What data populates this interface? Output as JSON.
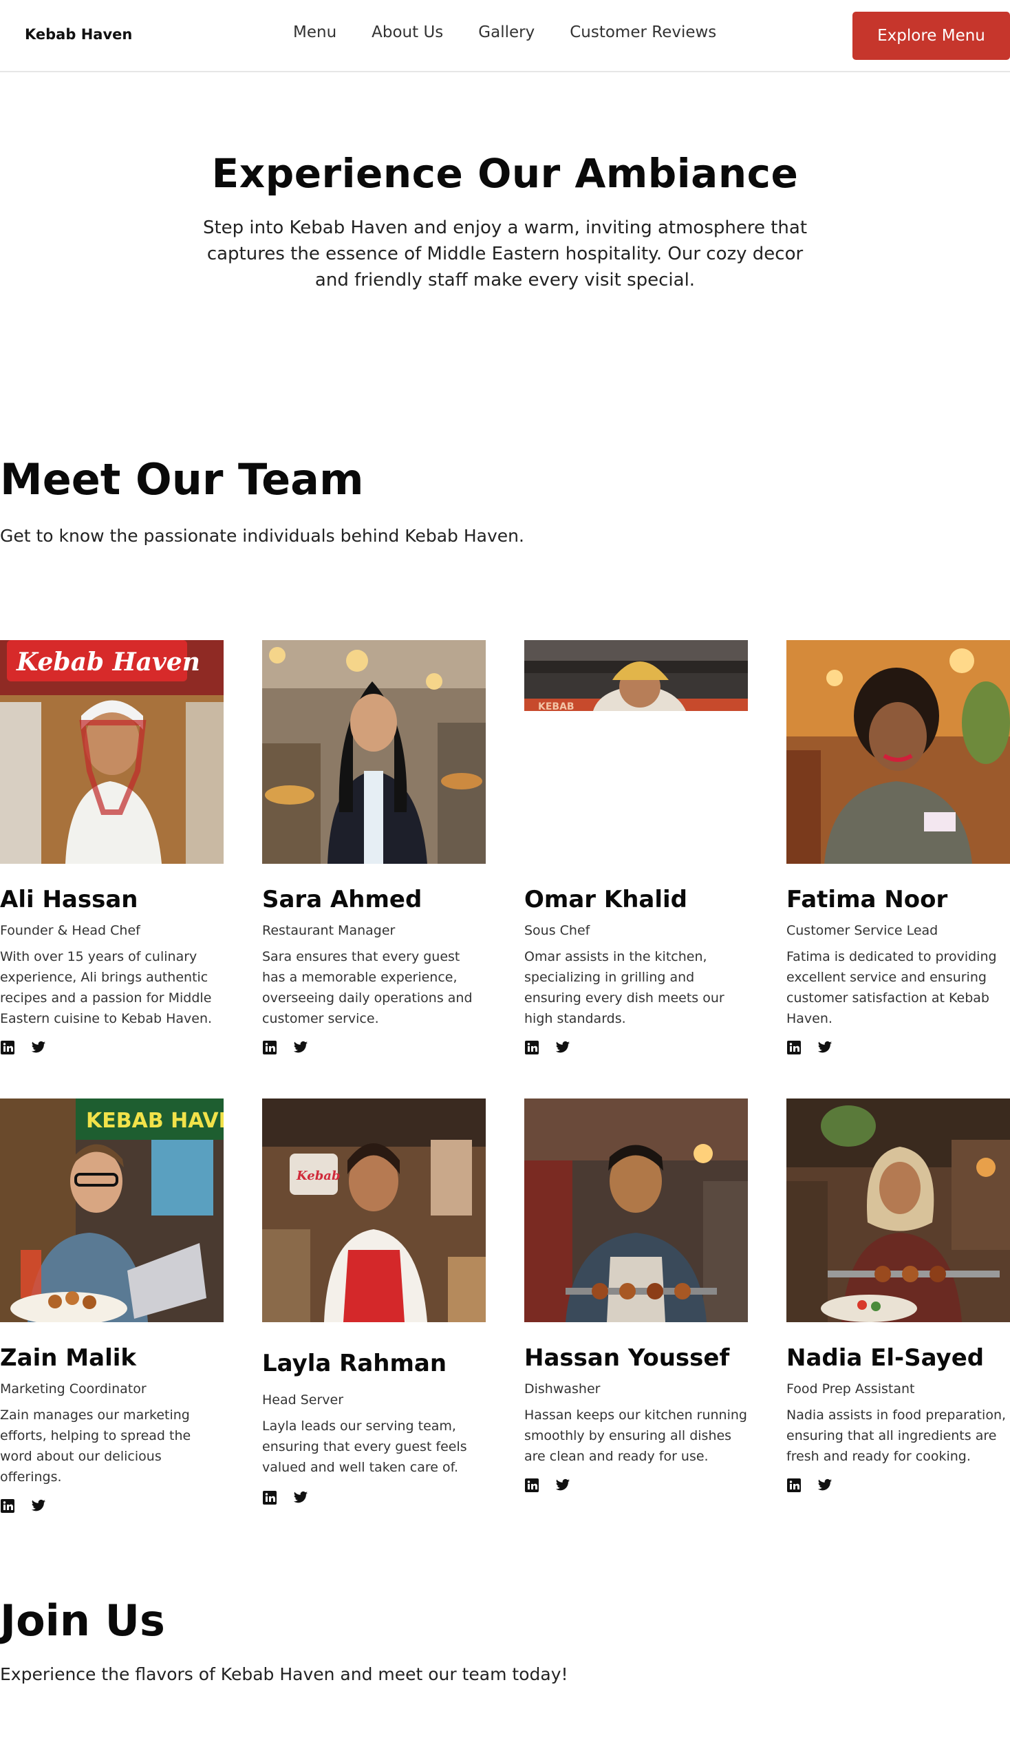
{
  "nav": {
    "brand": "Kebab Haven",
    "links": [
      "Menu",
      "About Us",
      "Gallery",
      "Customer Reviews"
    ],
    "cta": "Explore Menu"
  },
  "hero": {
    "title": "Experience Our Ambiance",
    "text": "Step into Kebab Haven and enjoy a warm, inviting atmosphere that captures the essence of Middle Eastern hospitality. Our cozy decor and friendly staff make every visit special."
  },
  "team": {
    "title": "Meet Our Team",
    "subtitle": "Get to know the passionate individuals behind Kebab Haven.",
    "members": [
      {
        "name": "Ali Hassan",
        "role": "Founder & Head Chef",
        "bio": "With over 15 years of culinary experience, Ali brings authentic recipes and a passion for Middle Eastern cuisine to Kebab Haven.",
        "photo_sign": "Kebab Haven"
      },
      {
        "name": "Sara Ahmed",
        "role": "Restaurant Manager",
        "bio": "Sara ensures that every guest has a memorable experience, overseeing daily operations and customer service."
      },
      {
        "name": "Omar Khalid",
        "role": "Sous Chef",
        "bio": "Omar assists in the kitchen, specializing in grilling and ensuring every dish meets our high standards.",
        "photo_sign": "KEBAB"
      },
      {
        "name": "Fatima Noor",
        "role": "Customer Service Lead",
        "bio": "Fatima is dedicated to providing excellent service and ensuring customer satisfaction at Kebab Haven."
      },
      {
        "name": "Zain Malik",
        "role": "Marketing Coordinator",
        "bio": "Zain manages our marketing efforts, helping to spread the word about our delicious offerings.",
        "photo_sign": "KEBAB HAVEN"
      },
      {
        "name": "Layla Rahman",
        "role": "Head Server",
        "bio": "Layla leads our serving team, ensuring that every guest feels valued and well taken care of.",
        "photo_sign": "Kebab"
      },
      {
        "name": "Hassan Youssef",
        "role": "Dishwasher",
        "bio": "Hassan keeps our kitchen running smoothly by ensuring all dishes are clean and ready for use."
      },
      {
        "name": "Nadia El-Sayed",
        "role": "Food Prep Assistant",
        "bio": "Nadia assists in food preparation, ensuring that all ingredients are fresh and ready for cooking."
      }
    ]
  },
  "join": {
    "title": "Join Us",
    "text": "Experience the flavors of Kebab Haven and meet our team today!"
  },
  "icons": {
    "social": [
      "linkedin-icon",
      "twitter-icon"
    ]
  },
  "colors": {
    "accent": "#c6362c"
  }
}
